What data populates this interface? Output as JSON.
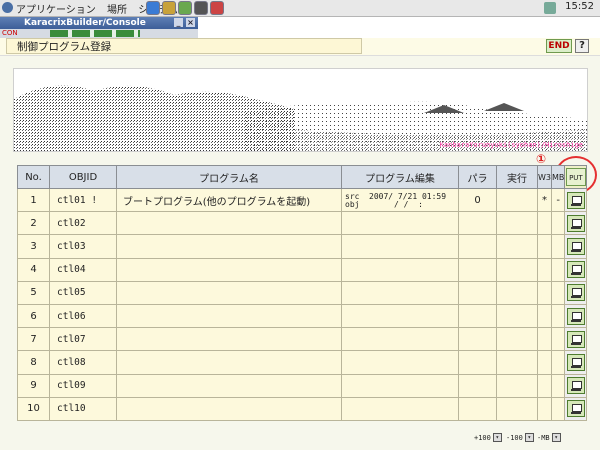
{
  "topbar": {
    "menus": [
      "アプリケーション",
      "場所",
      "システム"
    ],
    "clock": "15:52"
  },
  "window": {
    "title": "KaracrixBuilder/Console",
    "toolbar_label": "CON"
  },
  "header": {
    "title": "制御プログラム登録",
    "end_label": "END",
    "help_label": "?"
  },
  "banner": {
    "credit": "KanbaraYorunyuki(syohan)/Hiroshige"
  },
  "annotation": {
    "mark": "①"
  },
  "table": {
    "headers": {
      "no": "No.",
      "objid": "OBJID",
      "name": "プログラム名",
      "edit": "プログラム編集",
      "para": "パラ",
      "exec": "実行",
      "w3": "W3",
      "mb": "MB",
      "put": "PUT"
    },
    "rows": [
      {
        "no": "1",
        "objid": "ctl01 !",
        "name": "ブートプログラム(他のプログラムを起動)",
        "src": "src",
        "obj": "obj",
        "date1": "2007/ 7/21 01:59",
        "date2": "/ /  :",
        "para": "0",
        "exec": "",
        "w3": "*",
        "mb": "-"
      },
      {
        "no": "2",
        "objid": "ctl02",
        "name": "",
        "src": "",
        "obj": "",
        "date1": "",
        "date2": "",
        "para": "",
        "exec": "",
        "w3": "",
        "mb": ""
      },
      {
        "no": "3",
        "objid": "ctl03",
        "name": "",
        "src": "",
        "obj": "",
        "date1": "",
        "date2": "",
        "para": "",
        "exec": "",
        "w3": "",
        "mb": ""
      },
      {
        "no": "4",
        "objid": "ctl04",
        "name": "",
        "src": "",
        "obj": "",
        "date1": "",
        "date2": "",
        "para": "",
        "exec": "",
        "w3": "",
        "mb": ""
      },
      {
        "no": "5",
        "objid": "ctl05",
        "name": "",
        "src": "",
        "obj": "",
        "date1": "",
        "date2": "",
        "para": "",
        "exec": "",
        "w3": "",
        "mb": ""
      },
      {
        "no": "6",
        "objid": "ctl06",
        "name": "",
        "src": "",
        "obj": "",
        "date1": "",
        "date2": "",
        "para": "",
        "exec": "",
        "w3": "",
        "mb": ""
      },
      {
        "no": "7",
        "objid": "ctl07",
        "name": "",
        "src": "",
        "obj": "",
        "date1": "",
        "date2": "",
        "para": "",
        "exec": "",
        "w3": "",
        "mb": ""
      },
      {
        "no": "8",
        "objid": "ctl08",
        "name": "",
        "src": "",
        "obj": "",
        "date1": "",
        "date2": "",
        "para": "",
        "exec": "",
        "w3": "",
        "mb": ""
      },
      {
        "no": "9",
        "objid": "ctl09",
        "name": "",
        "src": "",
        "obj": "",
        "date1": "",
        "date2": "",
        "para": "",
        "exec": "",
        "w3": "",
        "mb": ""
      },
      {
        "no": "10",
        "objid": "ctl10",
        "name": "",
        "src": "",
        "obj": "",
        "date1": "",
        "date2": "",
        "para": "",
        "exec": "",
        "w3": "",
        "mb": ""
      }
    ]
  },
  "footer": {
    "plus100": "+100",
    "minus100": "-100",
    "mb": "-MB"
  },
  "colors": {
    "accent_green": "#6f9a4f",
    "row_bg": "#fdf9dc",
    "header_bg": "#d8dfe8",
    "annotation_red": "#e53030"
  }
}
